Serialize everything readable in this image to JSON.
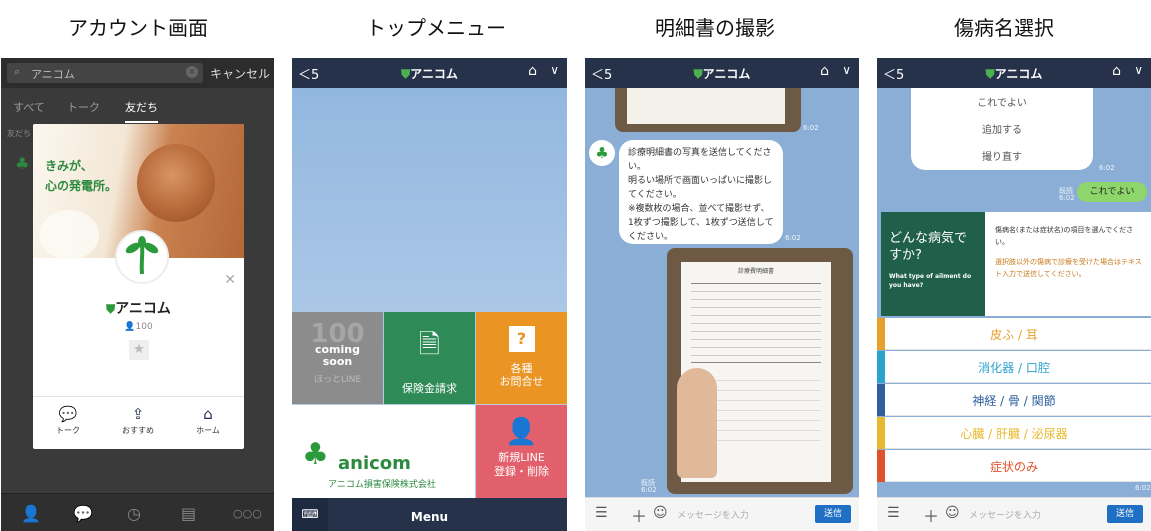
{
  "captions": [
    "アカウント画面",
    "トップメニュー",
    "明細書の撮影",
    "傷病名選択"
  ],
  "screen1": {
    "search_value": "アニコム",
    "cancel": "キャンセル",
    "tabs": [
      "すべて",
      "トーク",
      "友だち"
    ],
    "section": "友だち",
    "card": {
      "tagline1": "きみが、",
      "tagline2": "心の発電所。",
      "name": "アニコム",
      "count": "100",
      "actions": [
        "トーク",
        "おすすめ",
        "ホーム"
      ]
    }
  },
  "screen2": {
    "back": "5",
    "title": "アニコム",
    "tiles": {
      "soon1": "coming",
      "soon2": "soon",
      "soon3": "ほっとLINE",
      "claim": "保険金請求",
      "inquiry1": "各種",
      "inquiry2": "お問合せ",
      "brand": "anicom",
      "company": "アニコム損害保険株式会社",
      "register1": "新規LINE",
      "register2": "登録・削除"
    },
    "menu": "Menu"
  },
  "screen3": {
    "back": "5",
    "title": "アニコム",
    "message": "診療明細書の写真を送信してください。\n明るい場所で画面いっぱいに撮影してください。\n※複数枚の場合、並べて撮影せず、1枚ずつ撮影して、1枚ずつ送信してください。",
    "time": "6:02",
    "read": "既読",
    "placeholder": "メッセージを入力",
    "send": "送信",
    "doc_title": "診療費明細書"
  },
  "screen4": {
    "back": "5",
    "title": "アニコム",
    "choices": [
      "これでよい",
      "追加する",
      "撮り直す"
    ],
    "time": "6:02",
    "read": "既読",
    "reply": "これでよい",
    "question_jp": "どんな病気ですか?",
    "question_en": "What type of ailment do you have?",
    "instruction1": "傷病名(または症状名)の項目を選んでください。",
    "instruction2": "選択肢以外の傷病で診療を受けた場合はテキスト入力で送信してください。",
    "options": [
      {
        "label": "皮ふ / 耳",
        "color": "#e8a02c"
      },
      {
        "label": "消化器 / 口腔",
        "color": "#2aa3cf"
      },
      {
        "label": "神経 / 骨 / 関節",
        "color": "#2d5e9e"
      },
      {
        "label": "心臓 / 肝臓 / 泌尿器",
        "color": "#e8b92c"
      },
      {
        "label": "症状のみ",
        "color": "#e0522c"
      }
    ],
    "placeholder": "メッセージを入力",
    "send": "送信"
  }
}
